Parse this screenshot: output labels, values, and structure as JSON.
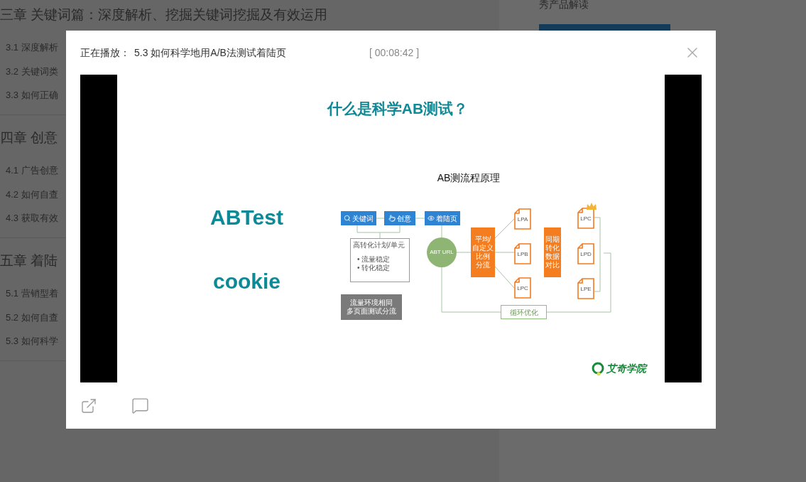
{
  "background_page": {
    "chapters": [
      {
        "title": "三章 关键词篇：深度解析、挖掘关键词挖掘及有效运用",
        "lessons": [
          "3.1 深度解析",
          "3.2 关键词类",
          "3.3 如何正确"
        ]
      },
      {
        "title": "四章 创意",
        "lessons": [
          "4.1 广告创意",
          "4.2 如何自查",
          "4.3 获取有效"
        ]
      },
      {
        "title": "五章 着陆",
        "lessons": [
          "5.1 营销型着",
          "5.2 如何自查",
          "5.3 如何科学"
        ]
      }
    ],
    "side_panel": {
      "text": "秀产品解读"
    }
  },
  "player_dialog": {
    "now_playing_label": "正在播放：",
    "lesson_title": "5.3 如何科学地用A/B法测试着陆页",
    "timestamp": "[ 00:08:42 ]",
    "slide": {
      "title": "什么是科学AB测试？",
      "terms": [
        "ABTest",
        "cookie"
      ],
      "diagram": {
        "title": "AB测流程原理",
        "steps": [
          "关键词",
          "创意",
          "着陆页"
        ],
        "plan_box": {
          "title": "高转化计划/单元",
          "bullets": [
            "• 流量稳定",
            "• 转化稳定"
          ]
        },
        "traffic_note": [
          "流量环境相同",
          "多页面测试分流"
        ],
        "abt_url": "ABT URL",
        "split_bar": [
          "平均/",
          "自定义",
          "比例",
          "分流"
        ],
        "variants_a": [
          "LPA",
          "LPB",
          "LPC"
        ],
        "compare_bar": [
          "同期",
          "转化",
          "数据",
          "对比"
        ],
        "variants_b": [
          {
            "label": "LPC",
            "winner": true
          },
          {
            "label": "LPD",
            "winner": false
          },
          {
            "label": "LPE",
            "winner": false
          }
        ],
        "loop": "循环优化"
      },
      "logo": "艾奇学院"
    }
  }
}
